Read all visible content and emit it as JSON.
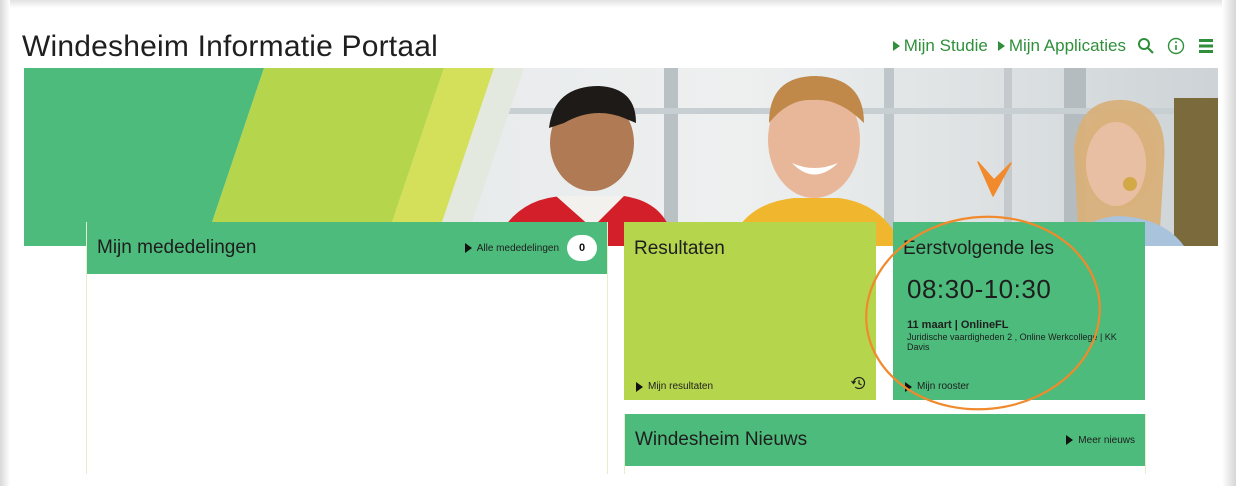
{
  "header": {
    "site_title": "Windesheim Informatie Portaal",
    "nav": [
      {
        "label": "Mijn Studie"
      },
      {
        "label": "Mijn Applicaties"
      }
    ],
    "icons": [
      "search-icon",
      "info-icon",
      "hamburger-menu-icon"
    ]
  },
  "mededelingen": {
    "title": "Mijn mededelingen",
    "all_link": "Alle mededelingen",
    "count": "0"
  },
  "resultaten": {
    "title": "Resultaten",
    "link": "Mijn resultaten"
  },
  "les": {
    "title": "Eerstvolgende les",
    "time": "08:30-10:30",
    "date_line": "11 maart | OnlineFL",
    "description": "Juridische vaardigheden 2 , Online Werkcollege | KK Davis",
    "link": "Mijn rooster"
  },
  "nieuws": {
    "title": "Windesheim Nieuws",
    "link": "Meer nieuws"
  },
  "colors": {
    "green": "#4cbb7b",
    "lime": "#b5d54d",
    "nav_green": "#2f8f3a",
    "annotation_orange": "#f08a2c"
  }
}
